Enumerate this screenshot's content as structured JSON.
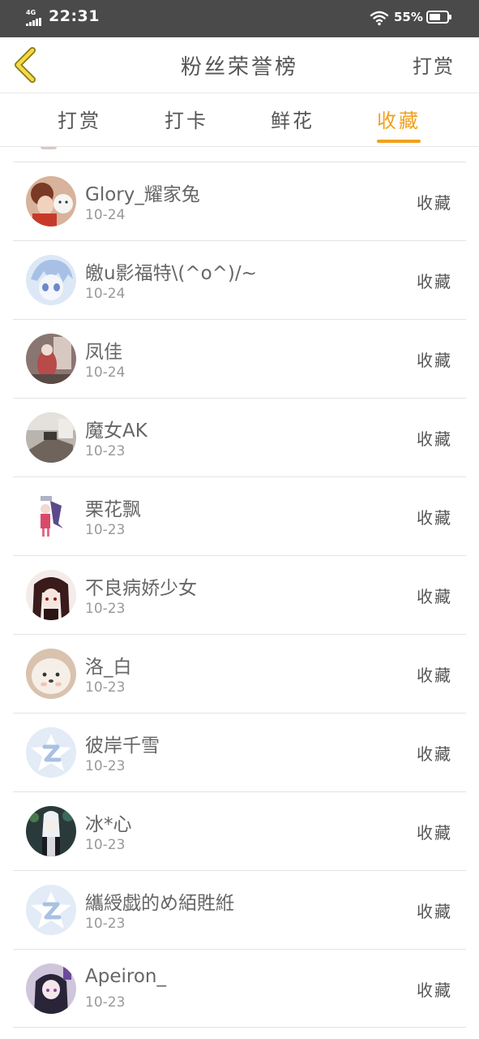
{
  "status_bar": {
    "network": "4G",
    "time": "22:31",
    "battery_percent": "55%"
  },
  "header": {
    "title": "粉丝荣誉榜",
    "right_action": "打赏"
  },
  "tabs": [
    {
      "label": "打赏",
      "active": false
    },
    {
      "label": "打卡",
      "active": false
    },
    {
      "label": "鲜花",
      "active": false
    },
    {
      "label": "收藏",
      "active": true
    }
  ],
  "accent_color": "#f0a11e",
  "list": [
    {
      "name": "Glory_耀家兔",
      "date": "10-24",
      "action": "收藏",
      "avatar": "photo-avatar"
    },
    {
      "name": "皦u影福特\\(^o^)/~",
      "date": "10-24",
      "action": "收藏",
      "avatar": "anime-avatar"
    },
    {
      "name": "凤佳",
      "date": "10-24",
      "action": "收藏",
      "avatar": "photo-avatar"
    },
    {
      "name": "魔女AK",
      "date": "10-23",
      "action": "收藏",
      "avatar": "photo-avatar"
    },
    {
      "name": "栗花飘",
      "date": "10-23",
      "action": "收藏",
      "avatar": "anime-avatar"
    },
    {
      "name": "不良病娇少女",
      "date": "10-23",
      "action": "收藏",
      "avatar": "anime-avatar"
    },
    {
      "name": "洛_白",
      "date": "10-23",
      "action": "收藏",
      "avatar": "photo-avatar"
    },
    {
      "name": "彼岸千雪",
      "date": "10-23",
      "action": "收藏",
      "avatar": "default-qq-avatar"
    },
    {
      "name": "冰*心",
      "date": "10-23",
      "action": "收藏",
      "avatar": "anime-avatar"
    },
    {
      "name": "纗綬戯的め絔貹絍",
      "date": "10-23",
      "action": "收藏",
      "avatar": "default-qq-avatar"
    },
    {
      "name": "Apeiron_",
      "date": "10-23",
      "action": "收藏",
      "avatar": "anime-avatar"
    }
  ]
}
